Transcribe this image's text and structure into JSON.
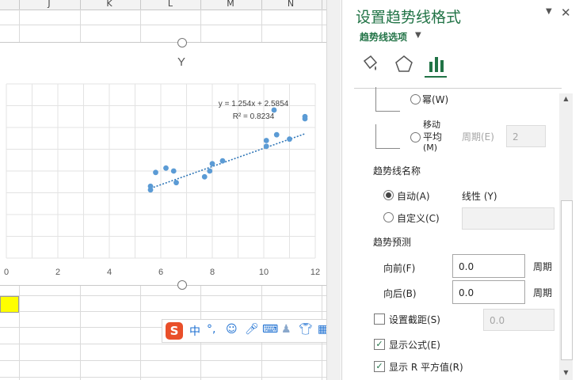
{
  "sheet": {
    "columns": [
      "J",
      "K",
      "L",
      "M",
      "N"
    ]
  },
  "chart_data": {
    "type": "scatter",
    "title": "Y",
    "xlim": [
      0,
      12
    ],
    "ylim": [
      0,
      24
    ],
    "x_ticks": [
      "0",
      "2",
      "4",
      "6",
      "8",
      "10",
      "12"
    ],
    "grid": true,
    "series": [
      {
        "x": [
          5.6,
          5.6,
          5.8,
          6.2,
          6.5,
          6.6,
          7.7,
          7.9,
          8.0,
          8.4,
          10.1,
          10.1,
          10.4,
          10.5,
          11.0,
          11.6,
          11.6
        ],
        "y": [
          9.4,
          9.9,
          11.8,
          12.4,
          12.0,
          10.4,
          11.2,
          12.0,
          13.0,
          13.4,
          16.2,
          15.4,
          20.4,
          17.0,
          16.4,
          19.2,
          19.5
        ]
      }
    ],
    "trendline": {
      "type": "linear",
      "slope": 1.254,
      "intercept": 2.5854,
      "x_range": [
        5.6,
        11.6
      ]
    },
    "annotations": {
      "equation": "y = 1.254x + 2.5854",
      "r2": "R² = 0.8234"
    }
  },
  "ime": {
    "logo": "S",
    "lang": "中",
    "punct": "°,"
  },
  "pane": {
    "title": "设置趋势线格式",
    "subtitle": "趋势线选项",
    "power_label": "幂(W)",
    "moving_avg_label1": "移动",
    "moving_avg_label2": "平均",
    "moving_avg_label3": "(M)",
    "period_label": "周期(E)",
    "period_value": "2",
    "name_section": "趋势线名称",
    "auto_label": "自动(A)",
    "auto_value": "线性 (Y)",
    "custom_label": "自定义(C)",
    "forecast_section": "趋势预测",
    "forward_label": "向前(F)",
    "forward_value": "0.0",
    "backward_label": "向后(B)",
    "backward_value": "0.0",
    "period_unit": "周期",
    "intercept_label": "设置截距(S)",
    "intercept_value": "0.0",
    "show_equation_label": "显示公式(E)",
    "show_r2_label": "显示 R 平方值(R)"
  },
  "colors": {
    "accent": "#217346",
    "marker": "#5b9bd5"
  }
}
